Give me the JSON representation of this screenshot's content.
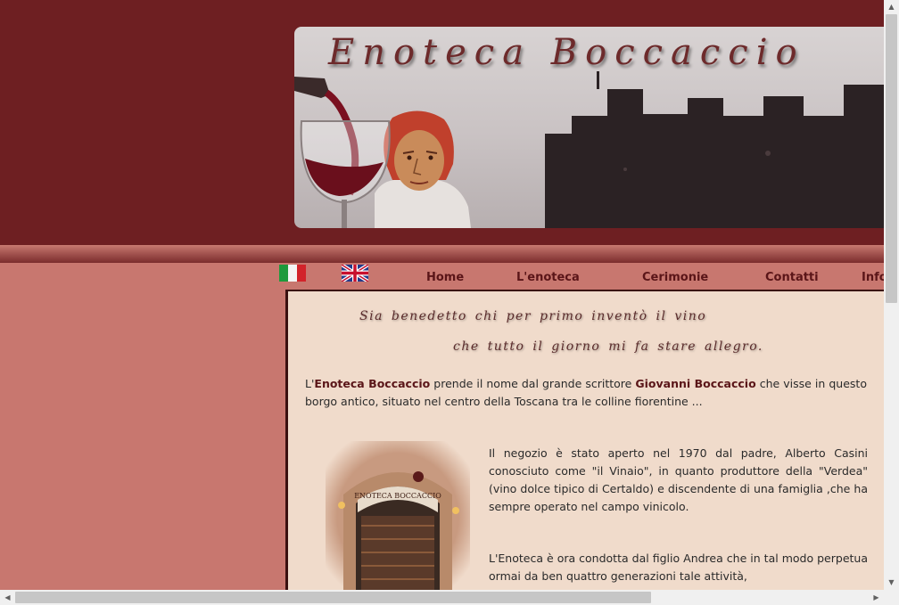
{
  "banner": {
    "title": "Enoteca Boccaccio"
  },
  "nav": {
    "flags": [
      {
        "name": "italian-flag-icon",
        "lang": "Italiano"
      },
      {
        "name": "uk-flag-icon",
        "lang": "English"
      }
    ],
    "items": [
      {
        "label": "Home"
      },
      {
        "label": "L'enoteca"
      },
      {
        "label": "Cerimonie"
      },
      {
        "label": "Contatti"
      },
      {
        "label": "Info"
      }
    ]
  },
  "content": {
    "quote_line_1": "Sia benedetto chi per primo inventò il vino",
    "quote_line_2": "che tutto il giorno  mi fa stare allegro.",
    "intro": {
      "p1": "L'",
      "name1": "Enoteca Boccaccio",
      "p2": " prende il nome dal grande scrittore ",
      "name2": "Giovanni Boccaccio",
      "p3": " che visse in questo borgo antico, situato nel centro della Toscana tra le colline fiorentine ..."
    },
    "para2": "Il negozio è stato aperto nel 1970 dal padre, Alberto Casini conosciuto come \"il Vinaio\", in quanto produttore della \"Verdea\" (vino dolce tipico di Certaldo) e discendente di una famiglia ,che ha sempre operato nel campo vinicolo.",
    "para3": "L'Enoteca è ora condotta dal figlio Andrea che in tal modo perpetua ormai da ben quattro generazioni tale attività,",
    "shop_sign": "ENOTECA BOCCACCIO"
  },
  "colors": {
    "header_bg": "#6e1f22",
    "nav_bg": "#c8776f",
    "content_bg": "#f0dbcb",
    "accent": "#5a1518"
  }
}
